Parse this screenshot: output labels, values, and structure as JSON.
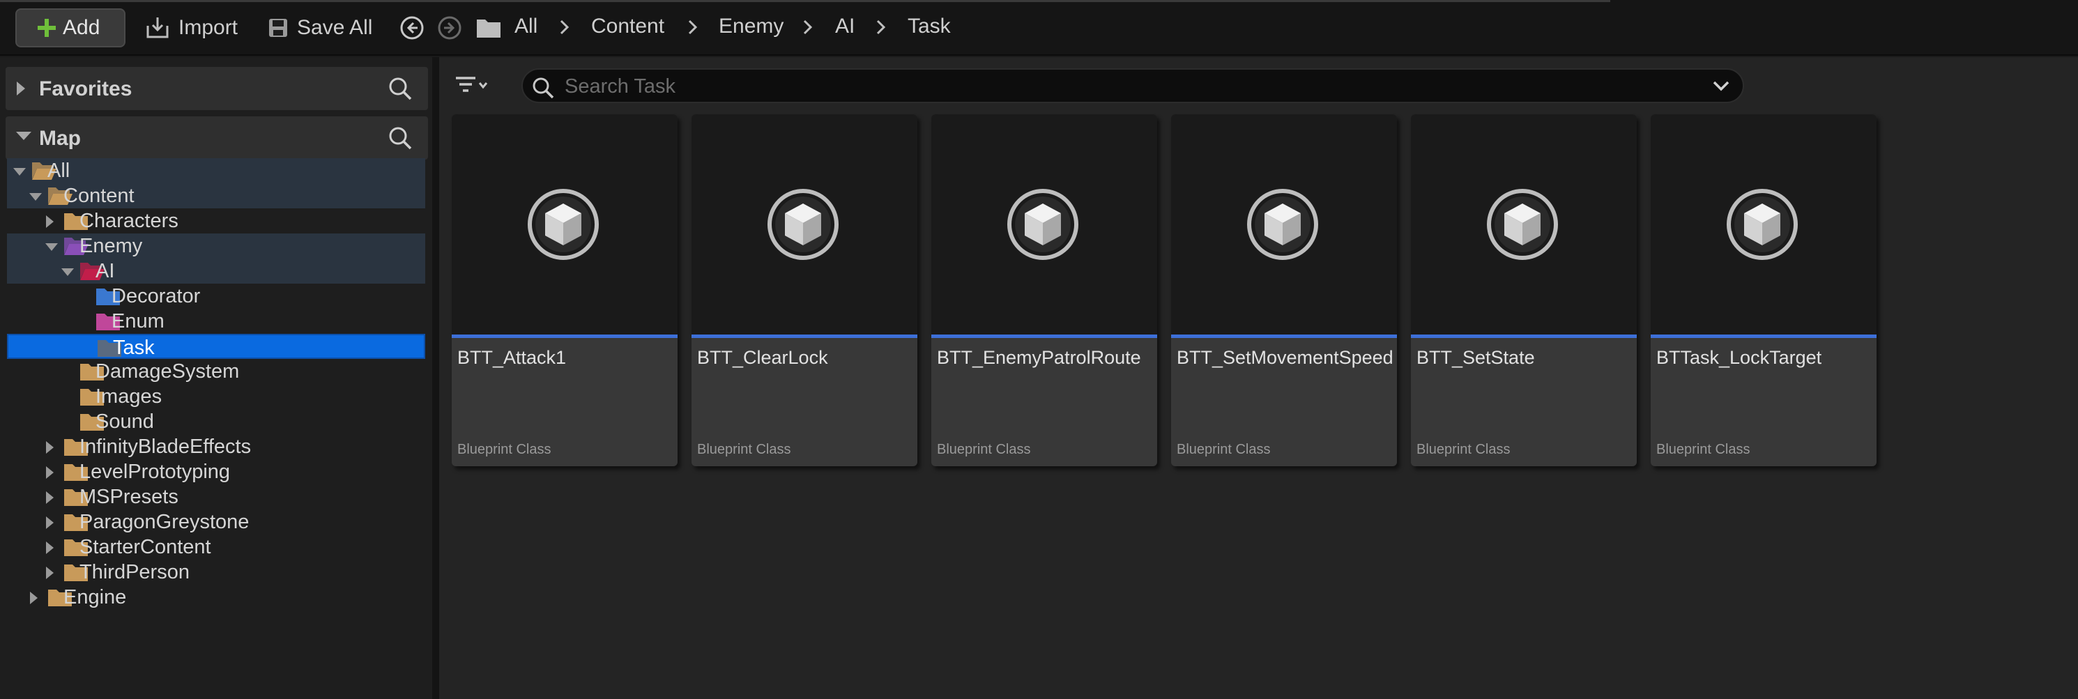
{
  "toolbar": {
    "add_label": "Add",
    "import_label": "Import",
    "save_all_label": "Save All",
    "breadcrumb": [
      "All",
      "Content",
      "Enemy",
      "AI",
      "Task"
    ]
  },
  "left_panel": {
    "favorites_title": "Favorites",
    "map_title": "Map",
    "tree": [
      {
        "label": "All",
        "depth": 0,
        "expanded": true,
        "folder": "open-tan",
        "state": "path"
      },
      {
        "label": "Content",
        "depth": 1,
        "expanded": true,
        "folder": "open-tan",
        "state": "path"
      },
      {
        "label": "Characters",
        "depth": 2,
        "expanded": false,
        "folder": "tan",
        "state": "none"
      },
      {
        "label": "Enemy",
        "depth": 2,
        "expanded": true,
        "folder": "open-purple",
        "state": "path"
      },
      {
        "label": "AI",
        "depth": 3,
        "expanded": true,
        "folder": "open-red",
        "state": "path"
      },
      {
        "label": "Decorator",
        "depth": 4,
        "expanded": null,
        "folder": "blue",
        "state": "none"
      },
      {
        "label": "Enum",
        "depth": 4,
        "expanded": null,
        "folder": "pink",
        "state": "none"
      },
      {
        "label": "Task",
        "depth": 4,
        "expanded": null,
        "folder": "grey",
        "state": "selected"
      },
      {
        "label": "DamageSystem",
        "depth": 3,
        "expanded": null,
        "folder": "tan",
        "state": "none"
      },
      {
        "label": "Images",
        "depth": 3,
        "expanded": null,
        "folder": "tan",
        "state": "none"
      },
      {
        "label": "Sound",
        "depth": 3,
        "expanded": null,
        "folder": "tan",
        "state": "none"
      },
      {
        "label": "InfinityBladeEffects",
        "depth": 2,
        "expanded": false,
        "folder": "tan",
        "state": "none"
      },
      {
        "label": "LevelPrototyping",
        "depth": 2,
        "expanded": false,
        "folder": "tan",
        "state": "none"
      },
      {
        "label": "MSPresets",
        "depth": 2,
        "expanded": false,
        "folder": "tan",
        "state": "none"
      },
      {
        "label": "ParagonGreystone",
        "depth": 2,
        "expanded": false,
        "folder": "tan",
        "state": "none"
      },
      {
        "label": "StarterContent",
        "depth": 2,
        "expanded": false,
        "folder": "tan",
        "state": "none"
      },
      {
        "label": "ThirdPerson",
        "depth": 2,
        "expanded": false,
        "folder": "tan",
        "state": "none"
      },
      {
        "label": "Engine",
        "depth": 1,
        "expanded": false,
        "folder": "tan",
        "state": "none"
      }
    ]
  },
  "content": {
    "search_placeholder": "Search Task",
    "assets": [
      {
        "name": "BTT_Attack1",
        "type": "Blueprint Class"
      },
      {
        "name": "BTT_ClearLock",
        "type": "Blueprint Class"
      },
      {
        "name": "BTT_EnemyPatrolRoute",
        "type": "Blueprint Class"
      },
      {
        "name": "BTT_SetMovementSpeed",
        "type": "Blueprint Class"
      },
      {
        "name": "BTT_SetState",
        "type": "Blueprint Class"
      },
      {
        "name": "BTTask_LockTarget",
        "type": "Blueprint Class"
      }
    ]
  },
  "colors": {
    "folder_tan": "#c89a5a",
    "folder_purple": "#8a4fb8",
    "folder_red": "#c21e4a",
    "folder_blue": "#3b78d0",
    "folder_pink": "#c0489a",
    "folder_grey": "#5a6a80",
    "selection": "#0a6ae0",
    "asset_bar": "#3d6fd8",
    "add_plus": "#6fbf3a"
  }
}
